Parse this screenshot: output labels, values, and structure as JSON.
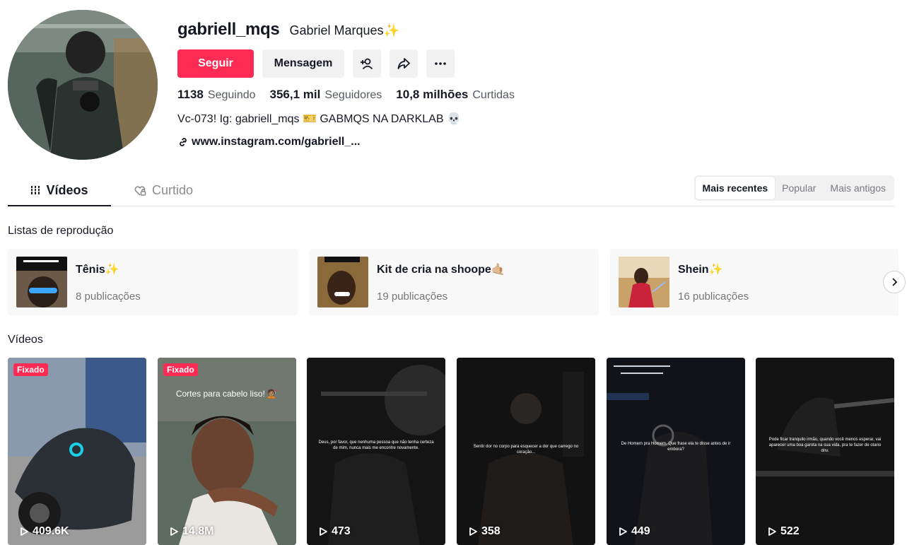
{
  "profile": {
    "username": "gabriell_mqs",
    "nickname": "Gabriel Marques✨",
    "follow_label": "Seguir",
    "message_label": "Mensagem",
    "stats": [
      {
        "value": "1138",
        "label": "Seguindo"
      },
      {
        "value": "356,1 mil",
        "label": "Seguidores"
      },
      {
        "value": "10,8 milhões",
        "label": "Curtidas"
      }
    ],
    "bio": "Vc-073! Ig: gabriell_mqs 🎫 GABMQS NA DARKLAB 💀",
    "link": "www.instagram.com/gabriell_..."
  },
  "tabs": {
    "videos": "Vídeos",
    "liked": "Curtido"
  },
  "sort": {
    "recent": "Mais recentes",
    "popular": "Popular",
    "oldest": "Mais antigos"
  },
  "playlists": {
    "title": "Listas de reprodução",
    "items": [
      {
        "name": "Tênis✨",
        "count": "8 publicações"
      },
      {
        "name": "Kit de cria na shoope🤙🏼",
        "count": "19 publicações"
      },
      {
        "name": "Shein✨",
        "count": "16 publicações"
      }
    ]
  },
  "videos": {
    "title": "Vídeos",
    "pinned_label": "Fixado",
    "items": [
      {
        "views": "409.6K",
        "pinned": true,
        "caption": ""
      },
      {
        "views": "14.8M",
        "pinned": true,
        "caption": "Cortes para cabelo liso! 💇🏽"
      },
      {
        "views": "473",
        "pinned": false,
        "caption": "Deus, por favor, que nenhuma pessoa que não tenha certeza de mim, nunca mais me encontre novamente."
      },
      {
        "views": "358",
        "pinned": false,
        "caption": "Sentir dor no corpo para esquecer a dor que carrego no coração..."
      },
      {
        "views": "449",
        "pinned": false,
        "caption": "De Homem pra Homem. Que frase ela te disse antes de ir embora?"
      },
      {
        "views": "522",
        "pinned": false,
        "caption": "Pode ficar tranquilo irmão, quando você menos esperar, vai aparecer uma boa garota na sua vida, pra te fazer de otario dnv."
      }
    ]
  },
  "colors": {
    "accent": "#fe2c55",
    "text": "#161823",
    "muted": "#757575"
  }
}
